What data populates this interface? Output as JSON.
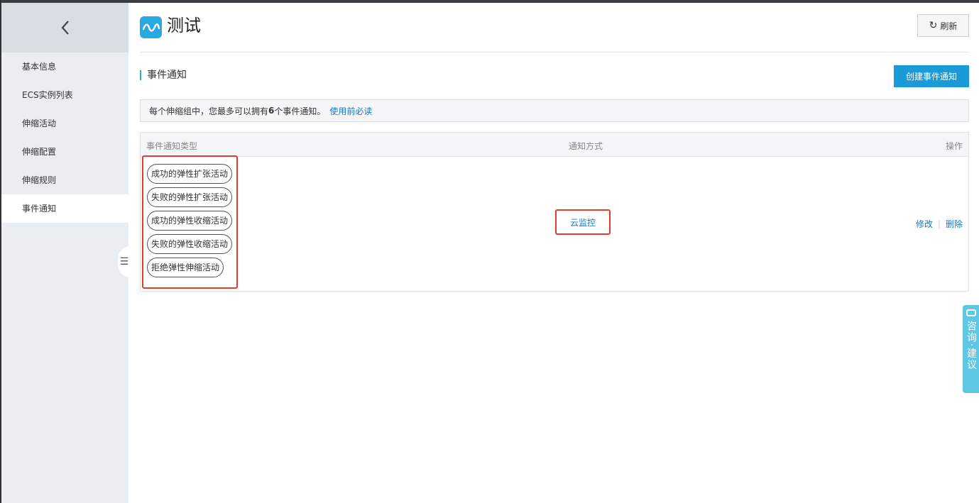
{
  "sidebar": {
    "items": [
      {
        "label": "基本信息"
      },
      {
        "label": "ECS实例列表"
      },
      {
        "label": "伸缩活动"
      },
      {
        "label": "伸缩配置"
      },
      {
        "label": "伸缩规则"
      },
      {
        "label": "事件通知"
      }
    ],
    "active_index": 5
  },
  "header": {
    "title": "测试",
    "refresh_label": "刷新"
  },
  "section": {
    "title": "事件通知",
    "create_label": "创建事件通知"
  },
  "notice": {
    "text_before": "每个伸缩组中，您最多可以拥有",
    "count": "6",
    "text_after": "个事件通知。",
    "link": "使用前必读"
  },
  "table": {
    "columns": [
      "事件通知类型",
      "通知方式",
      "操作"
    ],
    "row": {
      "types": [
        "成功的弹性扩张活动",
        "失败的弹性扩张活动",
        "成功的弹性收缩活动",
        "失败的弹性收缩活动",
        "拒绝弹性伸缩活动"
      ],
      "method": "云监控",
      "edit_label": "修改",
      "separator": "|",
      "delete_label": "删除"
    }
  },
  "float_button": {
    "label": "咨询·建议"
  },
  "colors": {
    "accent": "#1a9bd8",
    "highlight_border": "#e53a2f",
    "link": "#1a78c2"
  }
}
